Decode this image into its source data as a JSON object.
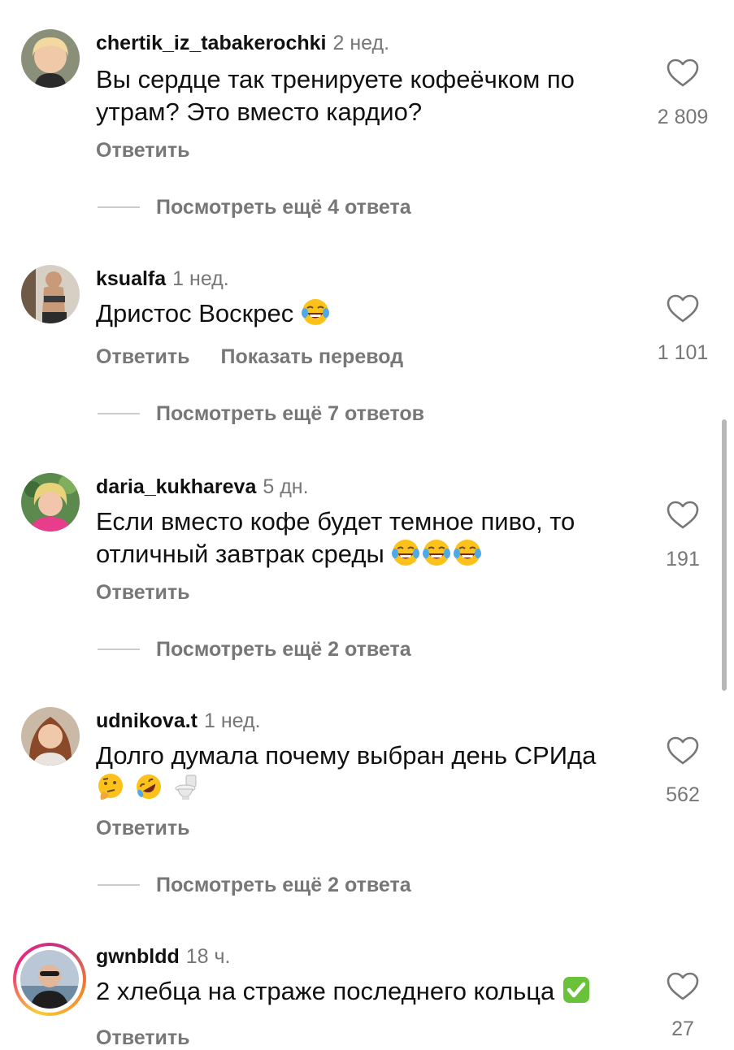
{
  "comments": [
    {
      "username": "chertik_iz_tabakerochki",
      "time": "2 нед.",
      "text_lines": [
        "Вы сердце так тренируете кофеёчком по",
        "утрам? Это вместо кардио?"
      ],
      "likes": "2 809",
      "reply_label": "Ответить",
      "view_replies": "Посмотреть ещё 4 ответа"
    },
    {
      "username": "ksualfa",
      "time": "1 нед.",
      "text_lines": [
        "Дристос Воскрес"
      ],
      "emojis": [
        "face-with-tears-of-joy"
      ],
      "likes": "1 101",
      "reply_label": "Ответить",
      "translate_label": "Показать перевод",
      "view_replies": "Посмотреть ещё 7 ответов"
    },
    {
      "username": "daria_kukhareva",
      "time": "5 дн.",
      "text_lines": [
        "Если вместо кофе будет темное пиво, то",
        "отличный завтрак среды"
      ],
      "emojis": [
        "face-with-tears-of-joy",
        "face-with-tears-of-joy",
        "face-with-tears-of-joy"
      ],
      "likes": "191",
      "reply_label": "Ответить",
      "view_replies": "Посмотреть ещё 2 ответа"
    },
    {
      "username": "udnikova.t",
      "time": "1 нед.",
      "text_lines": [
        "Долго думала почему выбран день СРИда"
      ],
      "emojis": [
        "thinking-face",
        "rolling-on-floor-laughing",
        "toilet"
      ],
      "likes": "562",
      "reply_label": "Ответить",
      "view_replies": "Посмотреть ещё 2 ответа"
    },
    {
      "username": "gwnbldd",
      "time": "18 ч.",
      "text_lines": [
        "2 хлебца на страже последнего кольца"
      ],
      "emojis": [
        "check-mark-button"
      ],
      "likes": "27",
      "reply_label": "Ответить",
      "has_story_ring": true
    }
  ],
  "icons": {
    "like": "heart-outline-icon"
  },
  "colors": {
    "text": "#111111",
    "secondary": "#777777",
    "divider": "#cccccc"
  }
}
